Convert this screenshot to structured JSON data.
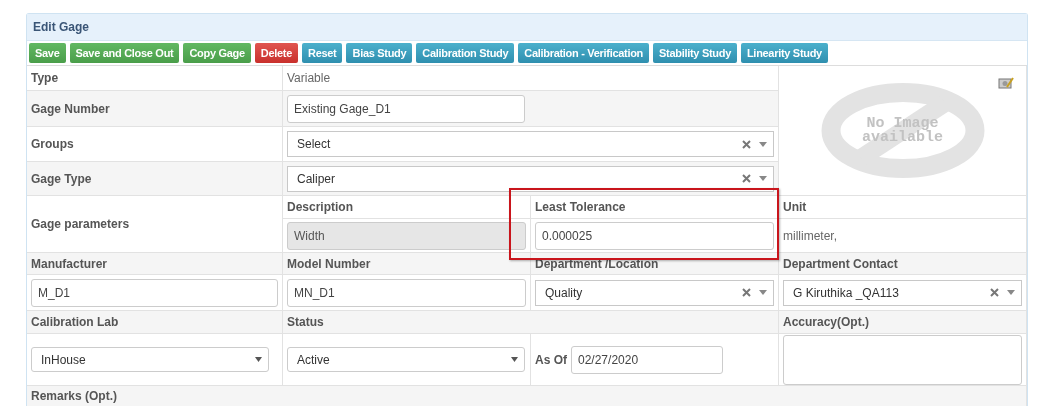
{
  "panel": {
    "title": "Edit Gage"
  },
  "buttons": [
    {
      "label": "Save",
      "kind": "success"
    },
    {
      "label": "Save and Close Out",
      "kind": "success"
    },
    {
      "label": "Copy Gage",
      "kind": "success"
    },
    {
      "label": "Delete",
      "kind": "danger"
    },
    {
      "label": "Reset",
      "kind": "info"
    },
    {
      "label": "Bias Study",
      "kind": "info"
    },
    {
      "label": "Calibration Study",
      "kind": "info"
    },
    {
      "label": "Calibration - Verification",
      "kind": "info"
    },
    {
      "label": "Stability Study",
      "kind": "info"
    },
    {
      "label": "Linearity Study",
      "kind": "info"
    }
  ],
  "type": {
    "label": "Type",
    "value": "Variable"
  },
  "gage_number": {
    "label": "Gage Number",
    "value": "Existing Gage_D1"
  },
  "groups": {
    "label": "Groups",
    "value": "Select"
  },
  "gage_type": {
    "label": "Gage Type",
    "value": "Caliper"
  },
  "image": {
    "text": "No Image available"
  },
  "gage_parameters": {
    "label": "Gage parameters",
    "description": {
      "label": "Description",
      "value": "Width",
      "disabled": true
    },
    "least_tolerance": {
      "label": "Least Tolerance",
      "value": "0.000025",
      "disabled": false,
      "highlighted": true
    },
    "unit": {
      "label": "Unit",
      "value": "millimeter,"
    }
  },
  "manufacturer": {
    "label": "Manufacturer",
    "value": "M_D1"
  },
  "model_number": {
    "label": "Model Number",
    "value": "MN_D1"
  },
  "department_location": {
    "label": "Department /Location",
    "value": "Quality"
  },
  "department_contact": {
    "label": "Department Contact",
    "value": "G Kiruthika _QA113"
  },
  "calibration_lab": {
    "label": "Calibration Lab",
    "value": "InHouse"
  },
  "status": {
    "label": "Status",
    "value": "Active"
  },
  "as_of": {
    "label": "As Of",
    "value": "02/27/2020"
  },
  "accuracy": {
    "label": "Accuracy(Opt.)"
  },
  "remarks": {
    "label": "Remarks (Opt.)"
  }
}
